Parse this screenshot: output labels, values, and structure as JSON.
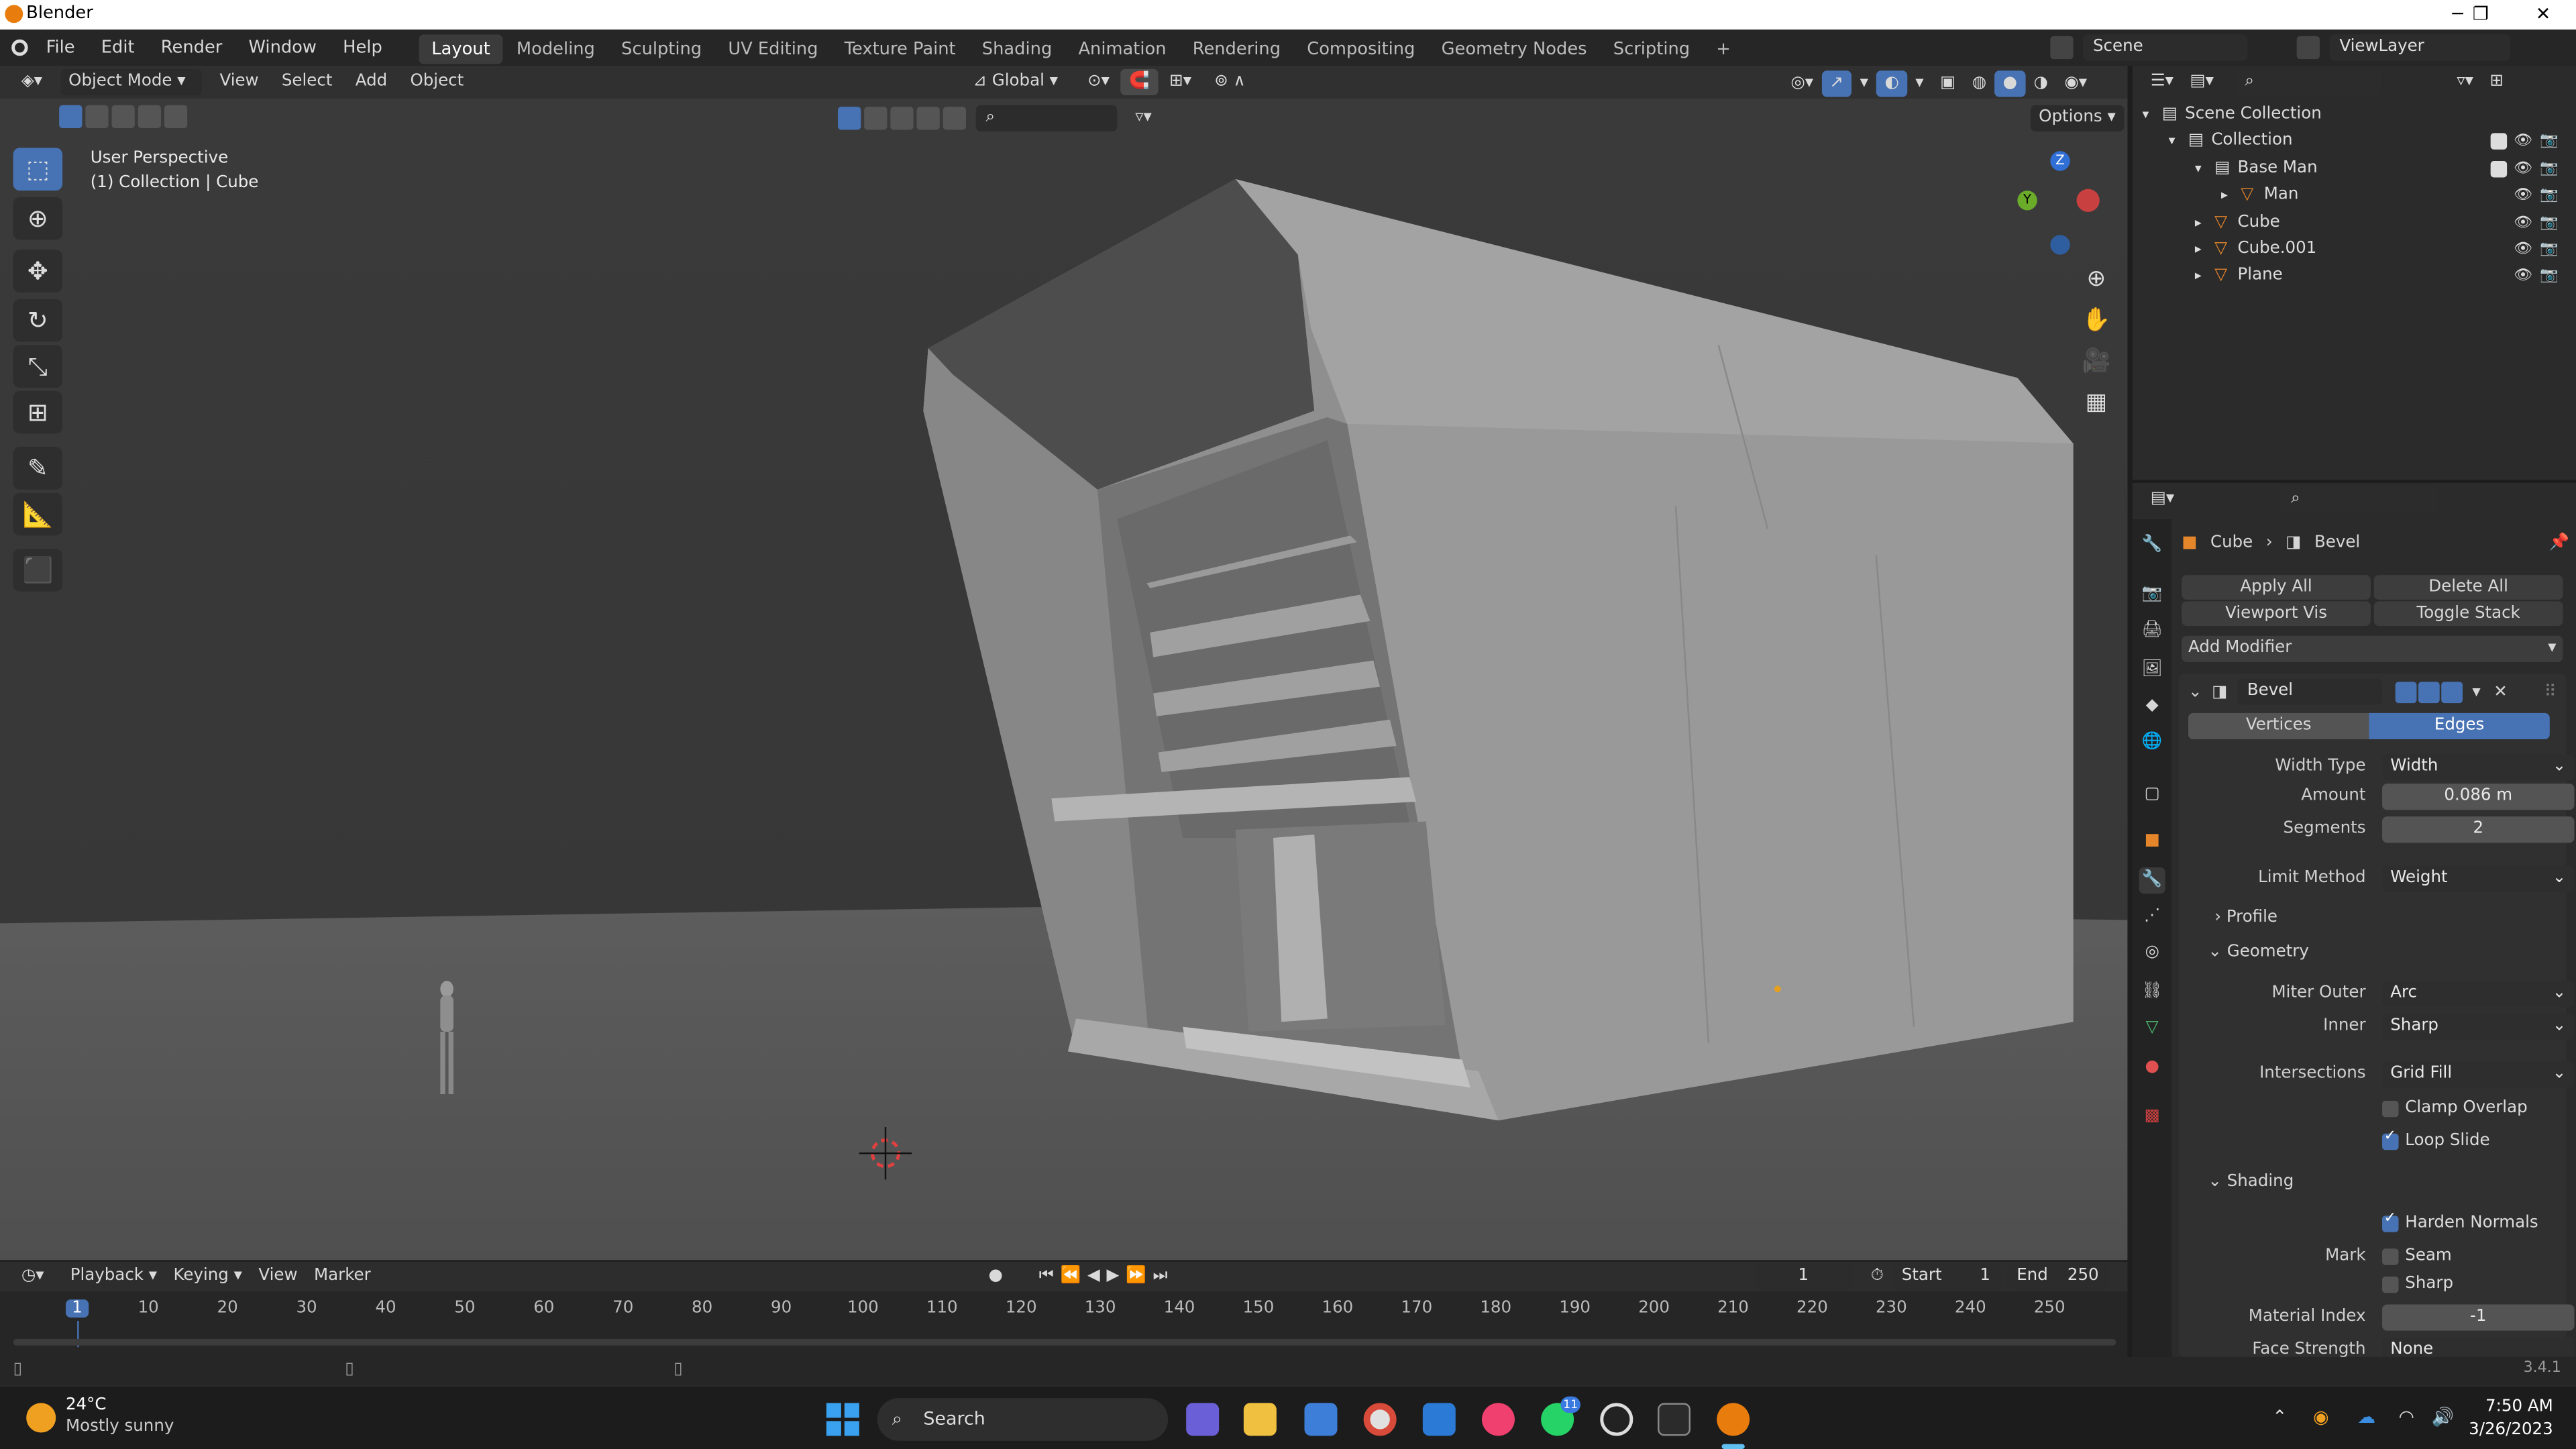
{
  "window": {
    "title": "Blender",
    "minimize": "─",
    "maximize": "❐",
    "close": "✕"
  },
  "menu": {
    "items": [
      "File",
      "Edit",
      "Render",
      "Window",
      "Help"
    ]
  },
  "workspaces": [
    "Layout",
    "Modeling",
    "Sculpting",
    "UV Editing",
    "Texture Paint",
    "Shading",
    "Animation",
    "Rendering",
    "Compositing",
    "Geometry Nodes",
    "Scripting",
    "+"
  ],
  "scene": {
    "label": "Scene",
    "view_layer": "ViewLayer"
  },
  "viewport_header": {
    "mode": "Object Mode",
    "menus": [
      "View",
      "Select",
      "Add",
      "Object"
    ],
    "orientation": "Global",
    "options": "Options"
  },
  "viewport_info": {
    "line1": "User Perspective",
    "line2": "(1) Collection | Cube"
  },
  "gizmo": {
    "z": "Z",
    "y": "Y"
  },
  "timeline": {
    "menus": [
      "Playback",
      "Keying",
      "View",
      "Marker"
    ],
    "current_frame": "1",
    "start_label": "Start",
    "start": "1",
    "end_label": "End",
    "end": "250",
    "ticks": [
      "1",
      "10",
      "20",
      "30",
      "40",
      "50",
      "60",
      "70",
      "80",
      "90",
      "100",
      "110",
      "120",
      "130",
      "140",
      "150",
      "160",
      "170",
      "180",
      "190",
      "200",
      "210",
      "220",
      "230",
      "240",
      "250"
    ]
  },
  "outliner": {
    "rows": [
      {
        "label": "Scene Collection",
        "indent": 0
      },
      {
        "label": "Collection",
        "indent": 1
      },
      {
        "label": "Base Man",
        "indent": 2
      },
      {
        "label": "Man",
        "indent": 3
      },
      {
        "label": "Cube",
        "indent": 2
      },
      {
        "label": "Cube.001",
        "indent": 2
      },
      {
        "label": "Plane",
        "indent": 2
      }
    ]
  },
  "properties": {
    "breadcrumb": {
      "object": "Cube",
      "modifier": "Bevel"
    },
    "apply_all": "Apply All",
    "delete_all": "Delete All",
    "viewport_vis": "Viewport Vis",
    "toggle_stack": "Toggle Stack",
    "add_modifier": "Add Modifier",
    "modifier_name": "Bevel",
    "affect": {
      "vertices": "Vertices",
      "edges": "Edges",
      "selected": "Edges"
    },
    "width_type": {
      "label": "Width Type",
      "value": "Width"
    },
    "amount": {
      "label": "Amount",
      "value": "0.086 m"
    },
    "segments": {
      "label": "Segments",
      "value": "2"
    },
    "limit_method": {
      "label": "Limit Method",
      "value": "Weight"
    },
    "profile": "Profile",
    "geometry": "Geometry",
    "miter_outer": {
      "label": "Miter Outer",
      "value": "Arc"
    },
    "inner": {
      "label": "Inner",
      "value": "Sharp"
    },
    "intersections": {
      "label": "Intersections",
      "value": "Grid Fill"
    },
    "clamp_overlap": {
      "label": "Clamp Overlap",
      "checked": false
    },
    "loop_slide": {
      "label": "Loop Slide",
      "checked": true
    },
    "shading": "Shading",
    "harden_normals": {
      "label": "Harden Normals",
      "checked": true
    },
    "mark_label": "Mark",
    "seam": {
      "label": "Seam",
      "checked": false
    },
    "sharp": {
      "label": "Sharp",
      "checked": false
    },
    "material_index": {
      "label": "Material Index",
      "value": "-1"
    },
    "face_strength": {
      "label": "Face Strength",
      "value": "None"
    }
  },
  "version": "3.4.1",
  "taskbar": {
    "weather_temp": "24°C",
    "weather_desc": "Mostly sunny",
    "search": "Search",
    "time": "7:50 AM",
    "date": "3/26/2023",
    "chat_badge": "11"
  }
}
